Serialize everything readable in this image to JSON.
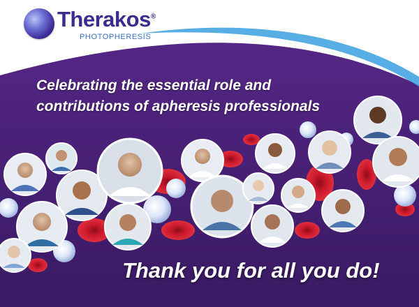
{
  "brand": {
    "name": "Therakos",
    "registered_mark": "®",
    "tagline": "PHOTOPHERESIS",
    "logo_icon": "globe-sphere-icon",
    "colors": {
      "background": "#4a2178",
      "swoosh": "#ffffff",
      "swoosh_accent": "#3aa0e0",
      "logo_text": "#3a2b8f",
      "tagline_text": "#3a6fc2"
    }
  },
  "headline": {
    "line1": "Celebrating the essential role and",
    "line2": "contributions of apheresis professionals"
  },
  "footer": {
    "message": "Thank you for all you do!"
  },
  "collage": {
    "portrait_icon": "person-portrait-icon",
    "blood_cell_icon": "red-blood-cell-icon",
    "white_cell_icon": "white-blood-cell-icon",
    "cell_colors": {
      "red": "#c8182a",
      "white": "#dbe6f7"
    }
  }
}
